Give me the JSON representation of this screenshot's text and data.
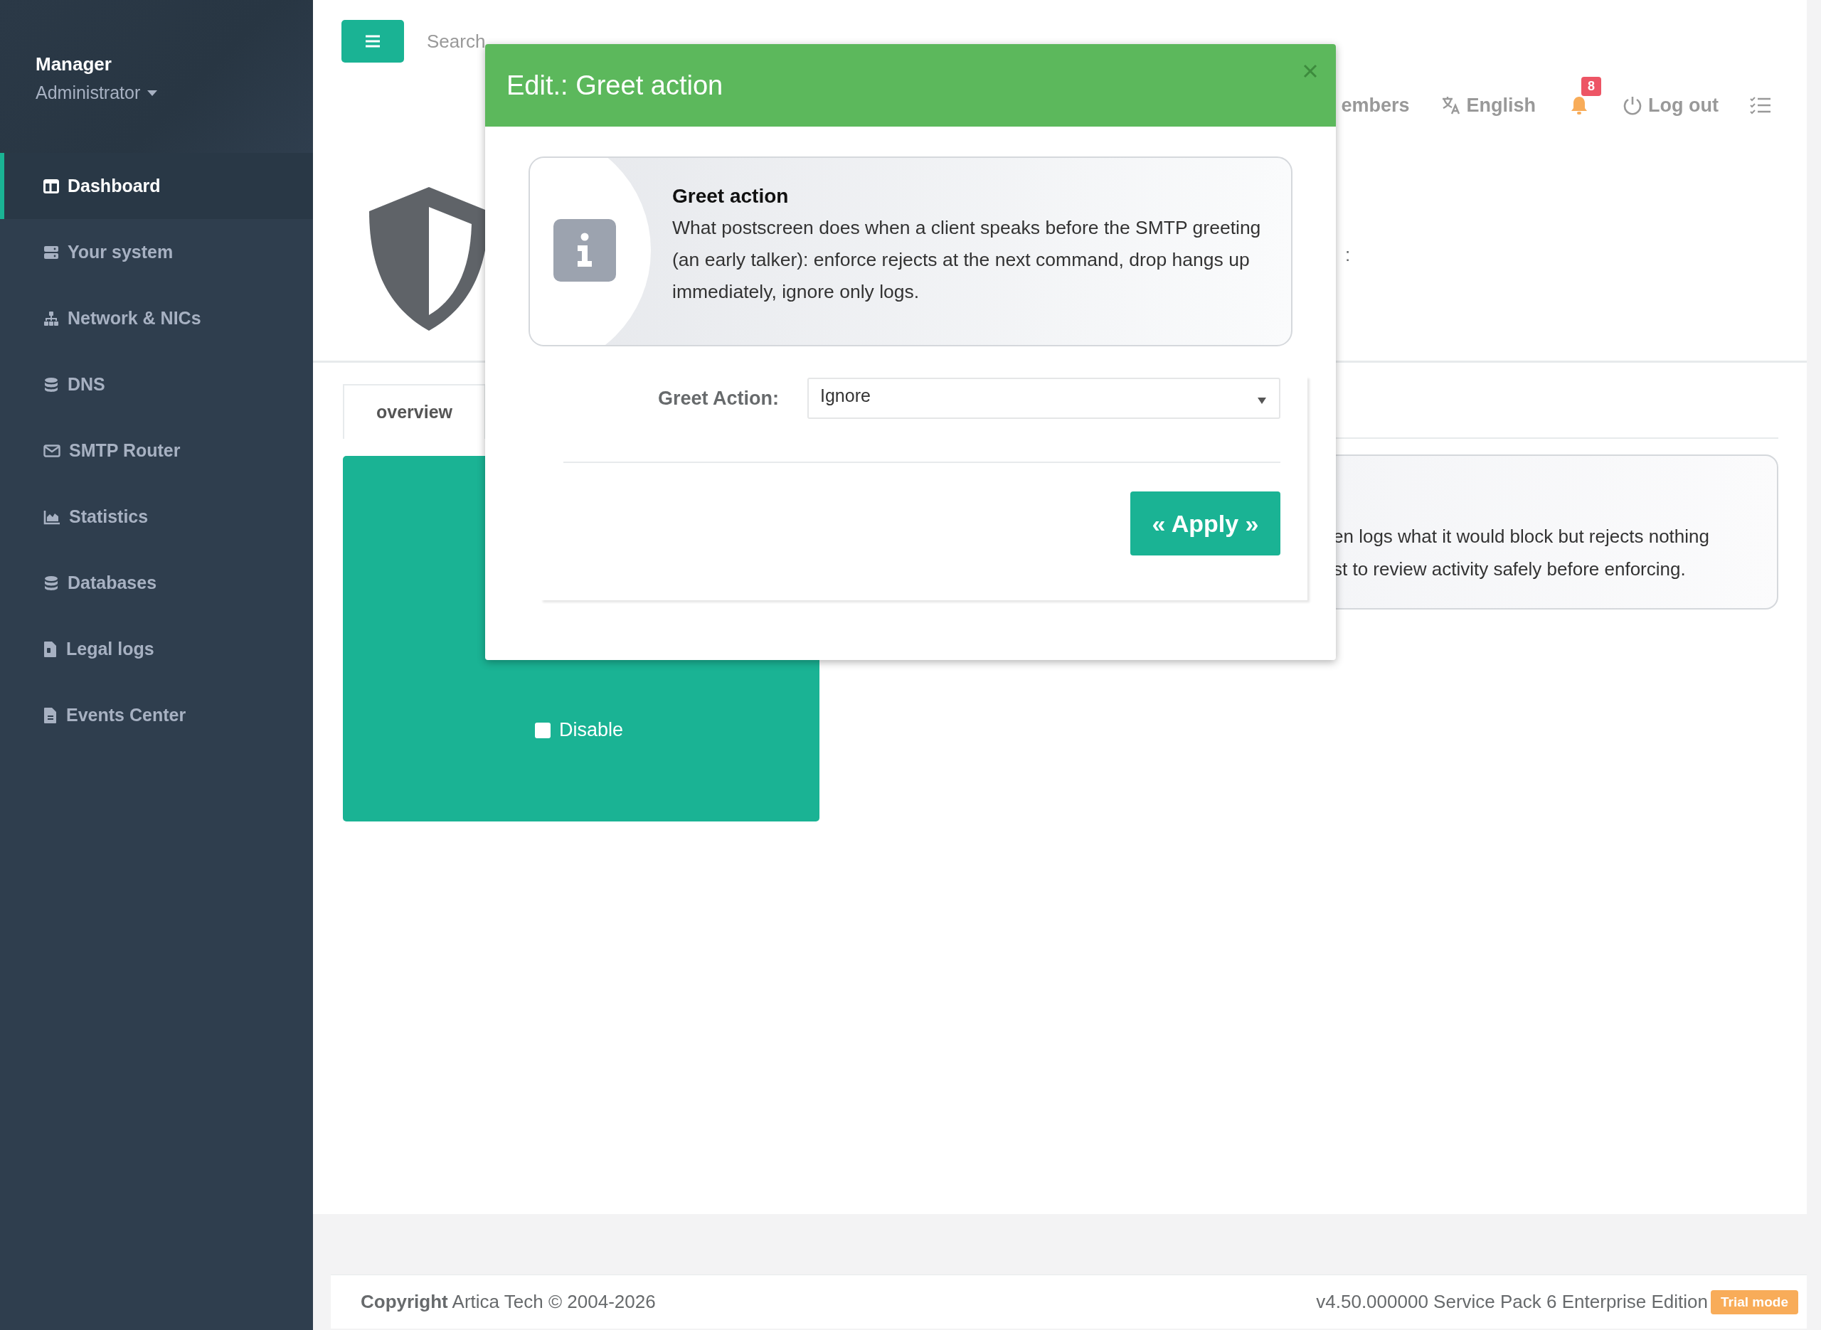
{
  "sidebar": {
    "user_name": "Manager",
    "user_role": "Administrator",
    "items": [
      {
        "label": "Dashboard",
        "selected": true
      },
      {
        "label": "Your system",
        "selected": false
      },
      {
        "label": "Network & NICs",
        "selected": false
      },
      {
        "label": "DNS",
        "selected": false
      },
      {
        "label": "SMTP Router",
        "selected": false
      },
      {
        "label": "Statistics",
        "selected": false
      },
      {
        "label": "Databases",
        "selected": false
      },
      {
        "label": "Legal logs",
        "selected": false
      },
      {
        "label": "Events Center",
        "selected": false
      }
    ]
  },
  "topbar": {
    "search": {
      "placeholder": "Search"
    },
    "links": [
      {
        "kind": "text",
        "label": "embers"
      },
      {
        "kind": "language",
        "label": "English"
      },
      {
        "kind": "notifications",
        "badge": "8"
      },
      {
        "kind": "logout",
        "label": "Log out"
      },
      {
        "kind": "tasks"
      }
    ]
  },
  "header": {
    "text_fragment": ":"
  },
  "tabs": [
    {
      "label": "overview",
      "selected": true
    }
  ],
  "status_card": {
    "checkbox": {
      "label": "Disable",
      "checked": false
    }
  },
  "info_panel": {
    "lines": [
      "en logs what it would block but rejects nothing",
      "st to review activity safely before enforcing."
    ]
  },
  "modal": {
    "title": "Edit.: Greet action",
    "info": {
      "title": "Greet action",
      "text": "What postscreen does when a client speaks before the SMTP greeting (an early talker): enforce rejects at the next command, drop hangs up immediately, ignore only logs."
    },
    "field": {
      "label": "Greet Action:",
      "value": "Ignore"
    },
    "apply": "« Apply »"
  },
  "footer": {
    "copyright_label": "Copyright",
    "copyright": "Artica Tech © 2004-2026",
    "version": "v4.50.000000 Service Pack 6 Enterprise Edition",
    "badge": "Trial mode"
  }
}
